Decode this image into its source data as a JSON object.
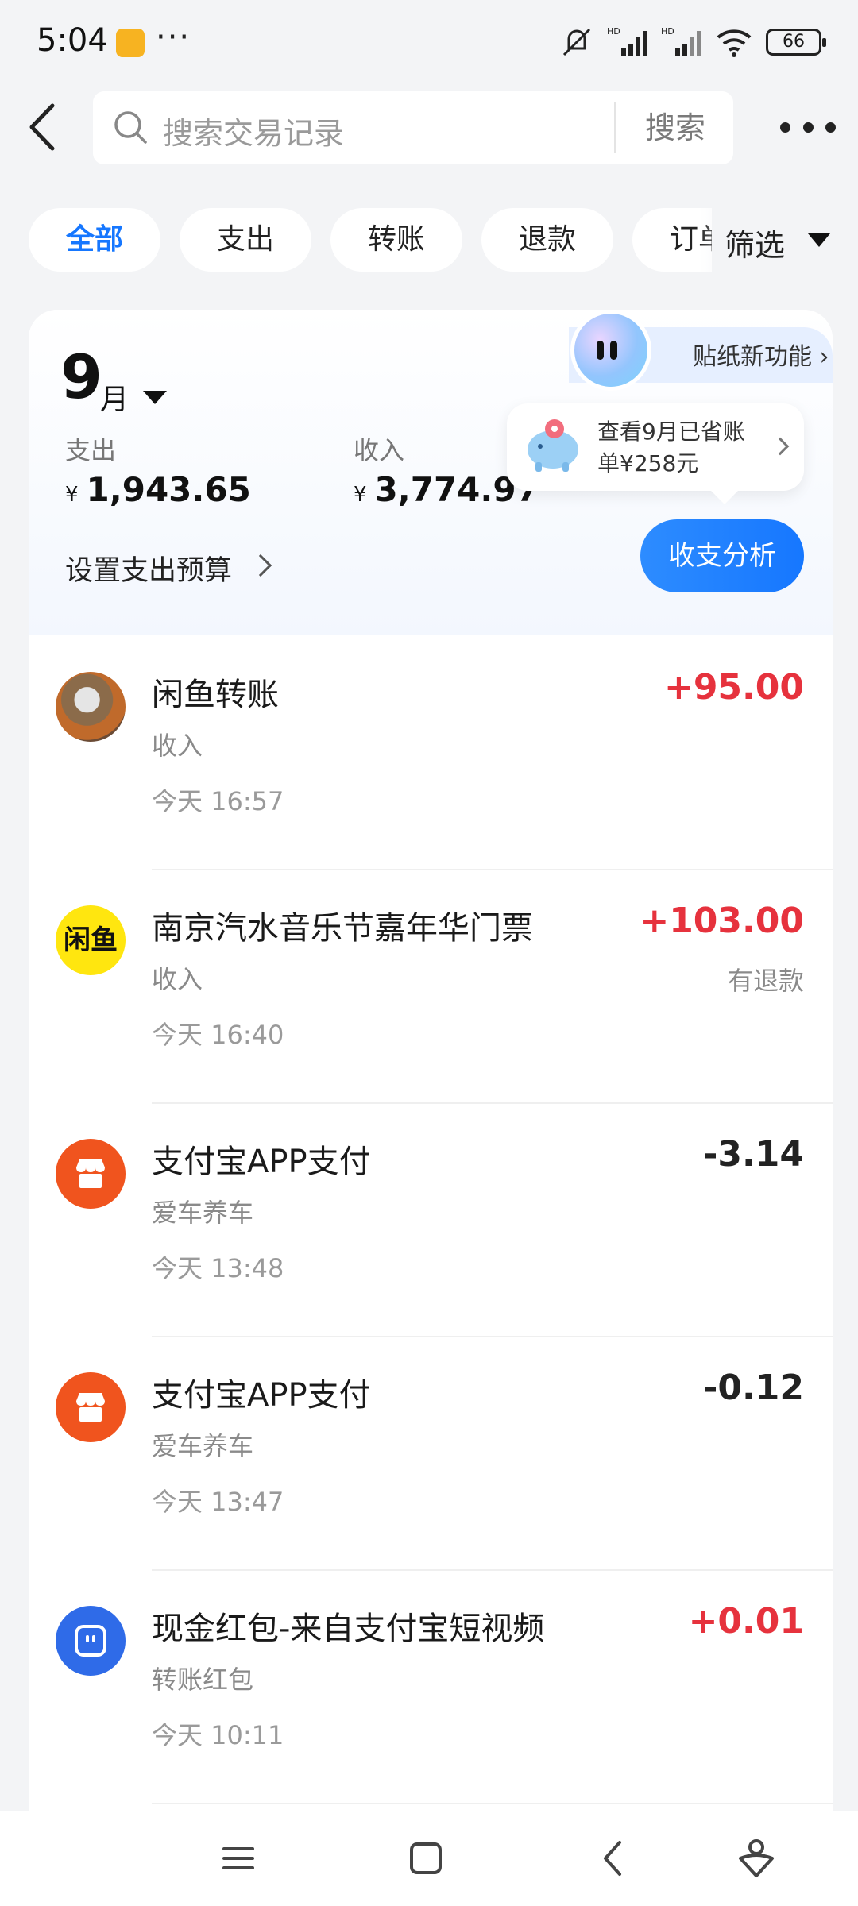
{
  "status_bar": {
    "time": "5:04",
    "dots": "···",
    "battery": "66"
  },
  "header": {
    "search_placeholder": "搜索交易记录",
    "search_button": "搜索"
  },
  "tabs": [
    {
      "label": "全部",
      "active": true
    },
    {
      "label": "支出",
      "active": false
    },
    {
      "label": "转账",
      "active": false
    },
    {
      "label": "退款",
      "active": false
    },
    {
      "label": "订单",
      "active": false
    }
  ],
  "filter": {
    "label": "筛选"
  },
  "summary": {
    "sticker_feature": "贴纸新功能 ›",
    "month_num": "9",
    "month_unit": "月",
    "expense_label": "支出",
    "expense_currency": "¥",
    "expense_value": "1,943.65",
    "income_label": "收入",
    "income_currency": "¥",
    "income_value": "3,774.97",
    "savings_line1": "查看9月已省账",
    "savings_line2": "单¥258元",
    "budget_label": "设置支出预算",
    "analysis_button": "收支分析"
  },
  "transactions": [
    {
      "name": "闲鱼转账",
      "category": "收入",
      "time": "今天 16:57",
      "amount": "+95.00",
      "note": "",
      "sign": "pos",
      "avatar": "photo"
    },
    {
      "name": "南京汽水音乐节嘉年华门票",
      "category": "收入",
      "time": "今天 16:40",
      "amount": "+103.00",
      "note": "有退款",
      "sign": "pos",
      "avatar": "xianyu",
      "avatar_text": "闲鱼"
    },
    {
      "name": "支付宝APP支付",
      "category": "爱车养车",
      "time": "今天 13:48",
      "amount": "-3.14",
      "note": "",
      "sign": "neg",
      "avatar": "shop"
    },
    {
      "name": "支付宝APP支付",
      "category": "爱车养车",
      "time": "今天 13:47",
      "amount": "-0.12",
      "note": "",
      "sign": "neg",
      "avatar": "shop"
    },
    {
      "name": "现金红包-来自支付宝短视频",
      "category": "转账红包",
      "time": "今天 10:11",
      "amount": "+0.01",
      "note": "",
      "sign": "pos",
      "avatar": "video"
    }
  ],
  "colors": {
    "accent": "#1677ff",
    "income": "#e6323d",
    "expense": "#222222"
  }
}
